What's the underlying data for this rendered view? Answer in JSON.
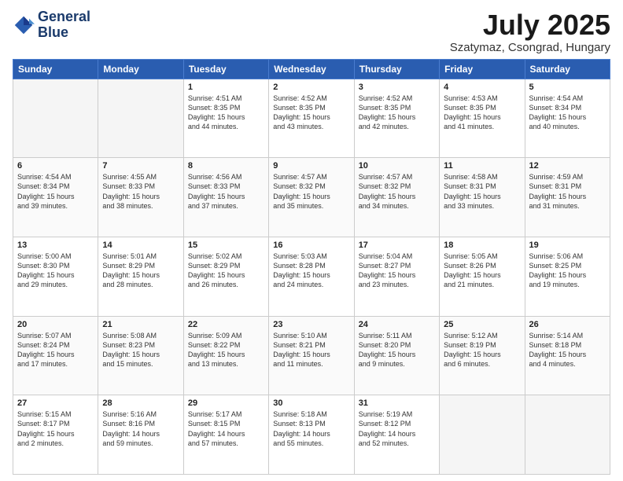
{
  "header": {
    "logo_line1": "General",
    "logo_line2": "Blue",
    "month": "July 2025",
    "location": "Szatymaz, Csongrad, Hungary"
  },
  "weekdays": [
    "Sunday",
    "Monday",
    "Tuesday",
    "Wednesday",
    "Thursday",
    "Friday",
    "Saturday"
  ],
  "weeks": [
    [
      {
        "day": "",
        "text": ""
      },
      {
        "day": "",
        "text": ""
      },
      {
        "day": "1",
        "text": "Sunrise: 4:51 AM\nSunset: 8:35 PM\nDaylight: 15 hours\nand 44 minutes."
      },
      {
        "day": "2",
        "text": "Sunrise: 4:52 AM\nSunset: 8:35 PM\nDaylight: 15 hours\nand 43 minutes."
      },
      {
        "day": "3",
        "text": "Sunrise: 4:52 AM\nSunset: 8:35 PM\nDaylight: 15 hours\nand 42 minutes."
      },
      {
        "day": "4",
        "text": "Sunrise: 4:53 AM\nSunset: 8:35 PM\nDaylight: 15 hours\nand 41 minutes."
      },
      {
        "day": "5",
        "text": "Sunrise: 4:54 AM\nSunset: 8:34 PM\nDaylight: 15 hours\nand 40 minutes."
      }
    ],
    [
      {
        "day": "6",
        "text": "Sunrise: 4:54 AM\nSunset: 8:34 PM\nDaylight: 15 hours\nand 39 minutes."
      },
      {
        "day": "7",
        "text": "Sunrise: 4:55 AM\nSunset: 8:33 PM\nDaylight: 15 hours\nand 38 minutes."
      },
      {
        "day": "8",
        "text": "Sunrise: 4:56 AM\nSunset: 8:33 PM\nDaylight: 15 hours\nand 37 minutes."
      },
      {
        "day": "9",
        "text": "Sunrise: 4:57 AM\nSunset: 8:32 PM\nDaylight: 15 hours\nand 35 minutes."
      },
      {
        "day": "10",
        "text": "Sunrise: 4:57 AM\nSunset: 8:32 PM\nDaylight: 15 hours\nand 34 minutes."
      },
      {
        "day": "11",
        "text": "Sunrise: 4:58 AM\nSunset: 8:31 PM\nDaylight: 15 hours\nand 33 minutes."
      },
      {
        "day": "12",
        "text": "Sunrise: 4:59 AM\nSunset: 8:31 PM\nDaylight: 15 hours\nand 31 minutes."
      }
    ],
    [
      {
        "day": "13",
        "text": "Sunrise: 5:00 AM\nSunset: 8:30 PM\nDaylight: 15 hours\nand 29 minutes."
      },
      {
        "day": "14",
        "text": "Sunrise: 5:01 AM\nSunset: 8:29 PM\nDaylight: 15 hours\nand 28 minutes."
      },
      {
        "day": "15",
        "text": "Sunrise: 5:02 AM\nSunset: 8:29 PM\nDaylight: 15 hours\nand 26 minutes."
      },
      {
        "day": "16",
        "text": "Sunrise: 5:03 AM\nSunset: 8:28 PM\nDaylight: 15 hours\nand 24 minutes."
      },
      {
        "day": "17",
        "text": "Sunrise: 5:04 AM\nSunset: 8:27 PM\nDaylight: 15 hours\nand 23 minutes."
      },
      {
        "day": "18",
        "text": "Sunrise: 5:05 AM\nSunset: 8:26 PM\nDaylight: 15 hours\nand 21 minutes."
      },
      {
        "day": "19",
        "text": "Sunrise: 5:06 AM\nSunset: 8:25 PM\nDaylight: 15 hours\nand 19 minutes."
      }
    ],
    [
      {
        "day": "20",
        "text": "Sunrise: 5:07 AM\nSunset: 8:24 PM\nDaylight: 15 hours\nand 17 minutes."
      },
      {
        "day": "21",
        "text": "Sunrise: 5:08 AM\nSunset: 8:23 PM\nDaylight: 15 hours\nand 15 minutes."
      },
      {
        "day": "22",
        "text": "Sunrise: 5:09 AM\nSunset: 8:22 PM\nDaylight: 15 hours\nand 13 minutes."
      },
      {
        "day": "23",
        "text": "Sunrise: 5:10 AM\nSunset: 8:21 PM\nDaylight: 15 hours\nand 11 minutes."
      },
      {
        "day": "24",
        "text": "Sunrise: 5:11 AM\nSunset: 8:20 PM\nDaylight: 15 hours\nand 9 minutes."
      },
      {
        "day": "25",
        "text": "Sunrise: 5:12 AM\nSunset: 8:19 PM\nDaylight: 15 hours\nand 6 minutes."
      },
      {
        "day": "26",
        "text": "Sunrise: 5:14 AM\nSunset: 8:18 PM\nDaylight: 15 hours\nand 4 minutes."
      }
    ],
    [
      {
        "day": "27",
        "text": "Sunrise: 5:15 AM\nSunset: 8:17 PM\nDaylight: 15 hours\nand 2 minutes."
      },
      {
        "day": "28",
        "text": "Sunrise: 5:16 AM\nSunset: 8:16 PM\nDaylight: 14 hours\nand 59 minutes."
      },
      {
        "day": "29",
        "text": "Sunrise: 5:17 AM\nSunset: 8:15 PM\nDaylight: 14 hours\nand 57 minutes."
      },
      {
        "day": "30",
        "text": "Sunrise: 5:18 AM\nSunset: 8:13 PM\nDaylight: 14 hours\nand 55 minutes."
      },
      {
        "day": "31",
        "text": "Sunrise: 5:19 AM\nSunset: 8:12 PM\nDaylight: 14 hours\nand 52 minutes."
      },
      {
        "day": "",
        "text": ""
      },
      {
        "day": "",
        "text": ""
      }
    ]
  ]
}
